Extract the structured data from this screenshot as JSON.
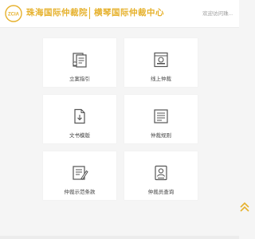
{
  "header": {
    "logo_mark_text": "ZCIA",
    "logo_text_1": "珠海国际仲裁院",
    "logo_text_2": "横琴国际仲裁中心",
    "welcome_text": "欢迎访问珠..."
  },
  "cards": [
    {
      "label": "立案指引",
      "icon": "guide-document-icon"
    },
    {
      "label": "线上仲裁",
      "icon": "online-arbitration-icon"
    },
    {
      "label": "文书模版",
      "icon": "document-template-icon"
    },
    {
      "label": "仲裁规则",
      "icon": "arbitration-rules-icon"
    },
    {
      "label": "仲裁示范条款",
      "icon": "model-clause-icon"
    },
    {
      "label": "仲裁员查询",
      "icon": "arbitrator-search-icon"
    }
  ],
  "colors": {
    "brand": "#e6b12c",
    "background": "#f5f5f5",
    "icon_ink": "#555555"
  },
  "back_to_top_icon": "double-chevron-up-icon"
}
